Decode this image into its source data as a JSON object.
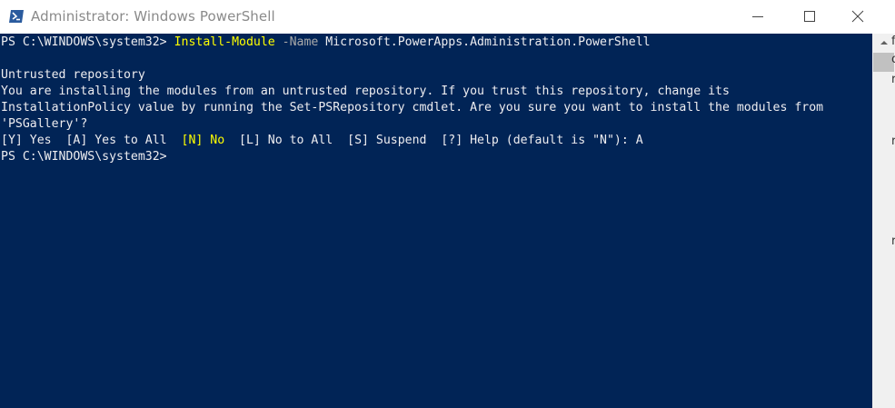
{
  "window": {
    "title": "Administrator: Windows PowerShell",
    "icon": "powershell-icon",
    "controls": {
      "minimize_icon": "minimize-icon",
      "maximize_icon": "maximize-icon",
      "close_icon": "close-icon"
    }
  },
  "console": {
    "background": "#012456",
    "foreground": "#EEEDF0",
    "command_color": "#FFFF00",
    "parameter_color": "#A9A9A9",
    "lines": {
      "l1": {
        "prompt": "PS C:\\WINDOWS\\system32> ",
        "command": "Install-Module",
        "param": " -Name",
        "arg": " Microsoft.PowerApps.Administration.PowerShell"
      },
      "l2": "Untrusted repository",
      "l3": "You are installing the modules from an untrusted repository. If you trust this repository, change its",
      "l4": "InstallationPolicy value by running the Set-PSRepository cmdlet. Are you sure you want to install the modules from",
      "l5": "'PSGallery'?",
      "l6": {
        "opt_y": "[Y] Yes  ",
        "opt_a": "[A] Yes to All  ",
        "opt_n": "[N] No",
        "rest": "  [L] No to All  [S] Suspend  [?] Help (default is \"N\"): A"
      },
      "l7": "PS C:\\WINDOWS\\system32>"
    }
  },
  "background_window": {
    "chars": [
      "f",
      "o",
      "r",
      "r",
      "r"
    ]
  }
}
